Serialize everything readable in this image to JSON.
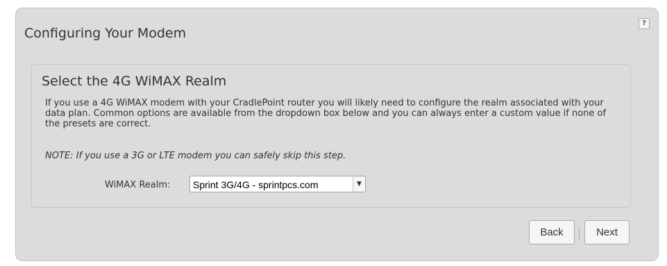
{
  "wizard": {
    "title": "Configuring Your Modem",
    "help_icon_glyph": "?",
    "section": {
      "title": "Select the 4G WiMAX Realm",
      "description": "If you use a 4G WiMAX modem with your CradlePoint router you will likely need to configure the realm associated with your data plan. Common options are available from the dropdown box below and you can always enter a custom value if none of the presets are correct.",
      "note": "NOTE: If you use a 3G or LTE modem you can safely skip this step.",
      "realm_label": "WiMAX Realm:",
      "realm_selected": "Sprint 3G/4G - sprintpcs.com"
    },
    "buttons": {
      "back": "Back",
      "next": "Next"
    }
  },
  "icons": {
    "help": "help-icon",
    "dropdown": "chevron-down-icon"
  },
  "colors": {
    "panel_background": "#dcdcdc",
    "panel_border": "#c4c4c4",
    "text": "#333333",
    "button_background": "#f5f5f5",
    "button_separator": "#9fb3d1"
  }
}
